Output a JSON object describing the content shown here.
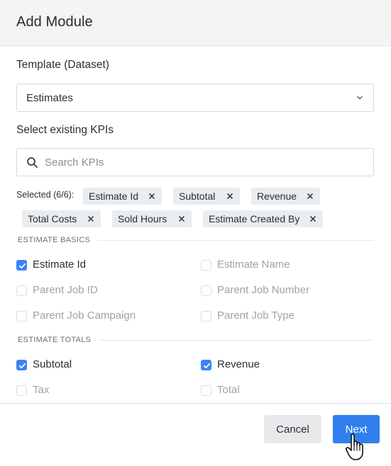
{
  "dialog": {
    "title": "Add Module"
  },
  "template": {
    "label": "Template (Dataset)",
    "value": "Estimates"
  },
  "kpis": {
    "label": "Select existing KPIs",
    "search_placeholder": "Search KPIs",
    "selected_label": "Selected (6/6):",
    "chips": [
      "Estimate Id",
      "Subtotal",
      "Revenue",
      "Total Costs",
      "Sold Hours",
      "Estimate Created By"
    ]
  },
  "sections": [
    {
      "title": "ESTIMATE BASICS",
      "items": [
        {
          "label": "Estimate Id",
          "checked": true,
          "disabled": false
        },
        {
          "label": "Estimate Name",
          "checked": false,
          "disabled": true
        },
        {
          "label": "Parent Job ID",
          "checked": false,
          "disabled": true
        },
        {
          "label": "Parent Job Number",
          "checked": false,
          "disabled": true
        },
        {
          "label": "Parent Job Campaign",
          "checked": false,
          "disabled": true
        },
        {
          "label": "Parent Job Type",
          "checked": false,
          "disabled": true
        }
      ]
    },
    {
      "title": "ESTIMATE TOTALS",
      "items": [
        {
          "label": "Subtotal",
          "checked": true,
          "disabled": false
        },
        {
          "label": "Revenue",
          "checked": true,
          "disabled": false
        },
        {
          "label": "Tax",
          "checked": false,
          "disabled": true
        },
        {
          "label": "Total",
          "checked": false,
          "disabled": true
        }
      ]
    }
  ],
  "footer": {
    "cancel_label": "Cancel",
    "next_label": "Next"
  },
  "colors": {
    "accent": "#2f80ed",
    "checkbox": "#3b82f6",
    "chip_bg": "#eaedf0",
    "header_bg": "#f4f4f5"
  }
}
